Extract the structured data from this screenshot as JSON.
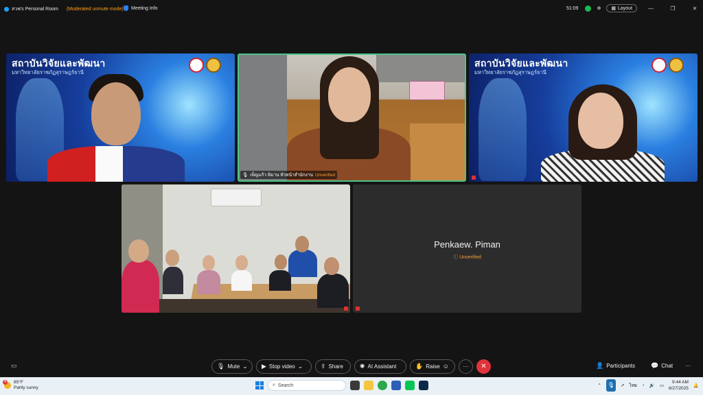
{
  "titlebar": {
    "room_name": "สวพ's Personal Room",
    "mode": "(Moderated unmute mode)",
    "meeting_info": "Meeting Info",
    "timer": "51:09",
    "layout_label": "Layout"
  },
  "tiles": {
    "t1": {
      "org_title": "สถาบันวิจัยและพัฒนา",
      "org_sub": "มหาวิทยาลัยราชภัฏสุราษฎร์ธานี"
    },
    "t2": {
      "name": "เพ็ญแก้ว  พิมาน  หัวหน้าสำนักงาน",
      "status": "Unverified"
    },
    "t3": {
      "org_title": "สถาบันวิจัยและพัฒนา",
      "org_sub": "มหาวิทยาลัยราชภัฏสุราษฎร์ธานี"
    },
    "t5": {
      "name": "Penkaew. Piman",
      "status": "Unverified"
    }
  },
  "controls": {
    "mute": "Mute",
    "stop_video": "Stop video",
    "share": "Share",
    "ai_assistant": "AI Assistant",
    "raise": "Raise",
    "more": "···",
    "end": "✕",
    "participants": "Participants",
    "chat": "Chat",
    "overflow": "···"
  },
  "taskbar": {
    "weather_temp": "85°F",
    "weather_desc": "Partly sunny",
    "notif_count": "4",
    "search_placeholder": "Search",
    "language": "ไทย",
    "time": "9:44 AM",
    "date": "8/27/2025"
  },
  "colors": {
    "active_speaker_border": "#49c48a",
    "end_button": "#e0333a",
    "unverified": "#f2a13a",
    "moderated": "#ff9f1a"
  }
}
